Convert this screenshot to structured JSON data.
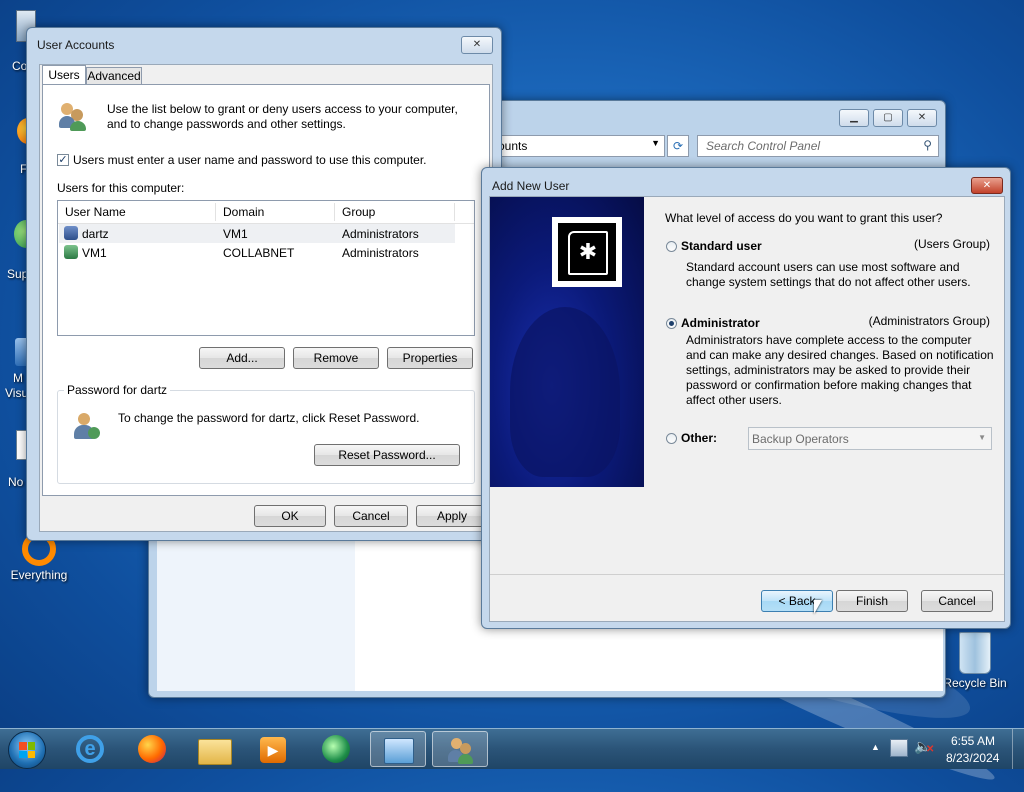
{
  "desktop": {
    "icons": [
      {
        "label": "Everything",
        "icon": "everything-icon"
      },
      {
        "label": "Recycle Bin",
        "icon": "recycle-bin-icon"
      }
    ],
    "partial_labels": [
      "Co",
      "F",
      "Sup",
      "M",
      "Visu",
      "No"
    ]
  },
  "control_panel": {
    "address_text": "ounts",
    "search_placeholder": "Search Control Panel"
  },
  "user_accounts": {
    "title": "User Accounts",
    "tabs": [
      "Users",
      "Advanced"
    ],
    "intro_line1": "Use the list below to grant or deny users access to your computer,",
    "intro_line2": "and to change passwords and other settings.",
    "require_password_label": "Users must enter a user name and password to use this computer.",
    "require_password_checked": true,
    "users_label": "Users for this computer:",
    "columns": [
      "User Name",
      "Domain",
      "Group"
    ],
    "rows": [
      {
        "name": "dartz",
        "domain": "VM1",
        "group": "Administrators"
      },
      {
        "name": "VM1",
        "domain": "COLLABNET",
        "group": "Administrators"
      }
    ],
    "add_button": "Add...",
    "remove_button": "Remove",
    "properties_button": "Properties",
    "password_group_label": "Password for dartz",
    "password_text": "To change the password for dartz, click Reset Password.",
    "reset_button": "Reset Password...",
    "ok_button": "OK",
    "cancel_button": "Cancel",
    "apply_button": "Apply"
  },
  "add_new_user": {
    "title": "Add New User",
    "question": "What level of access do you want to grant this user?",
    "standard_label": "Standard user",
    "standard_group": "(Users Group)",
    "standard_desc1": "Standard account users can use most software and",
    "standard_desc2": "change system settings that do not affect other users.",
    "admin_label": "Administrator",
    "admin_group": "(Administrators Group)",
    "admin_desc": [
      "Administrators have complete access to the computer",
      "and can make any desired changes. Based on notification",
      "settings, administrators may be asked to provide their",
      "password or confirmation before making changes that",
      "affect other users."
    ],
    "selected": "Administrator",
    "other_label": "Other:",
    "other_value": "Backup Operators",
    "back_button": "< Back",
    "finish_button": "Finish",
    "cancel_button": "Cancel"
  },
  "taskbar": {
    "time": "6:55 AM",
    "date": "8/23/2024"
  }
}
